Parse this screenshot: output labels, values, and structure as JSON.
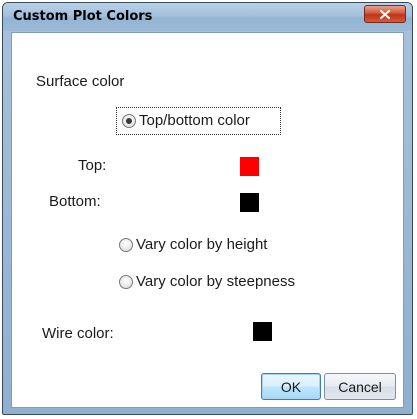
{
  "window": {
    "title": "Custom Plot Colors",
    "close_label": "x"
  },
  "surface": {
    "heading": "Surface color",
    "options": [
      {
        "label": "Top/bottom color",
        "selected": true
      },
      {
        "label": "Vary color by height",
        "selected": false
      },
      {
        "label": "Vary color by steepness",
        "selected": false
      }
    ],
    "top_label": "Top:",
    "top_color": "#ff0000",
    "bottom_label": "Bottom:",
    "bottom_color": "#000000"
  },
  "wire": {
    "label": "Wire color:",
    "color": "#000000"
  },
  "buttons": {
    "ok": "OK",
    "cancel": "Cancel"
  }
}
